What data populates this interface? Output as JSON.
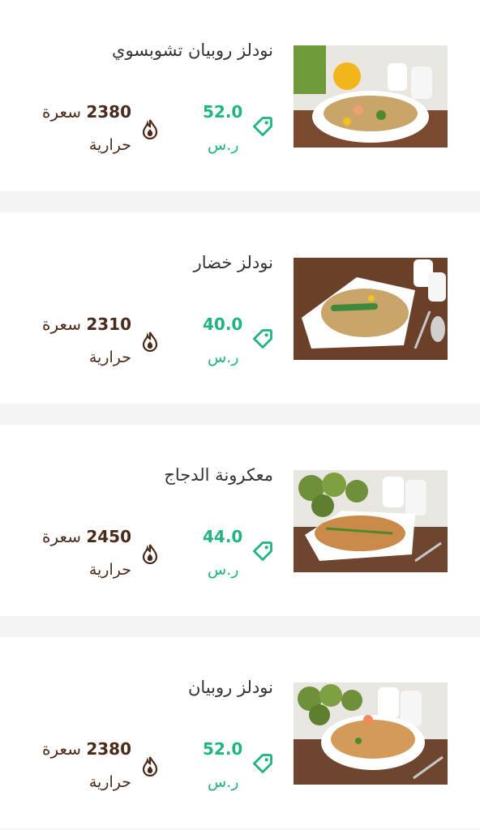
{
  "accent_color": "#1fb57c",
  "calorie_color": "#4a2a1a",
  "items": [
    {
      "name": "نودلز روبيان تشوبسوي",
      "price": "52.0",
      "currency": "ر.س",
      "calories": "2380",
      "calorie_unit": "سعرة",
      "calorie_unit_2": "حرارية",
      "image": "shrimp-chop-suey-noodles-photo"
    },
    {
      "name": "نودلز خضار",
      "price": "40.0",
      "currency": "ر.س",
      "calories": "2310",
      "calorie_unit": "سعرة",
      "calorie_unit_2": "حرارية",
      "image": "vegetable-noodles-photo"
    },
    {
      "name": "معكرونة الدجاج",
      "price": "44.0",
      "currency": "ر.س",
      "calories": "2450",
      "calorie_unit": "سعرة",
      "calorie_unit_2": "حرارية",
      "image": "chicken-pasta-photo"
    },
    {
      "name": "نودلز روبيان",
      "price": "52.0",
      "currency": "ر.س",
      "calories": "2380",
      "calorie_unit": "سعرة",
      "calorie_unit_2": "حرارية",
      "image": "shrimp-noodles-photo"
    }
  ]
}
